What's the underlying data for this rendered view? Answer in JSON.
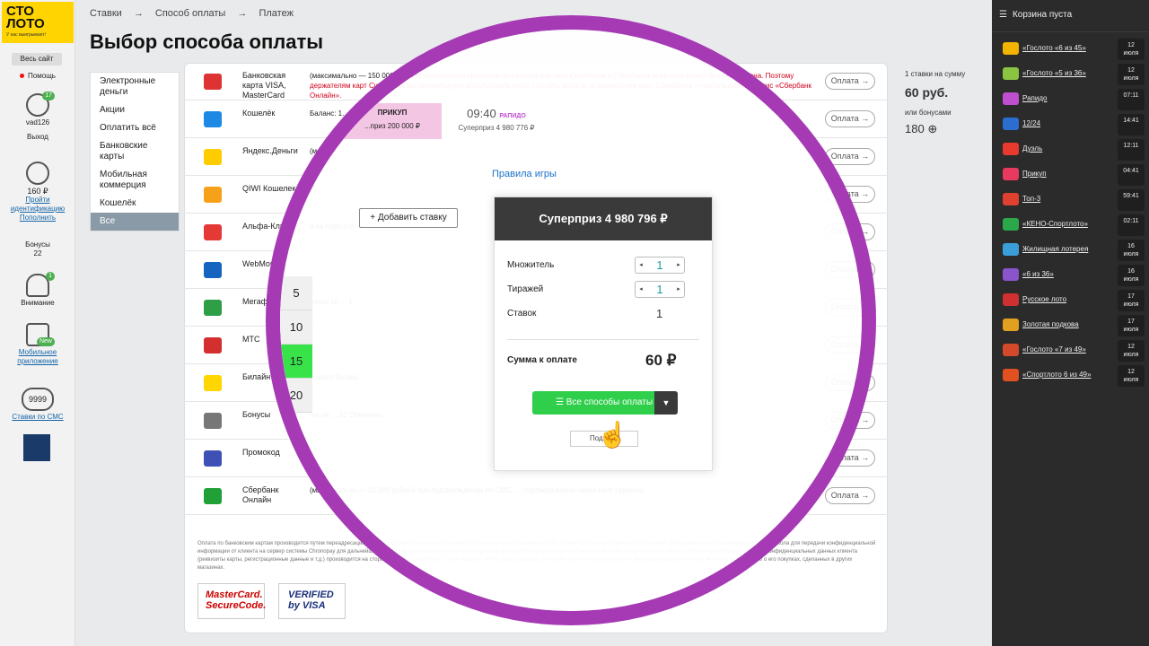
{
  "logo": {
    "line1": "СТО",
    "line2": "ЛОТО",
    "tagline": "У нас выигрывают!"
  },
  "left_sidebar": {
    "all_sites": "Весь сайт",
    "help": "Помощь",
    "user": "vad126",
    "user_badge": "17",
    "logout": "Выход",
    "balance": "160 ₽",
    "id_link": "Пройти идентификацию",
    "topup": "Пополнить",
    "bonuses_label": "Бонусы",
    "bonuses_value": "22",
    "attention_label": "Внимание",
    "attention_badge": "1",
    "mobile_label": "Мобильное приложение",
    "mobile_badge": "New",
    "sms_label": "Ставки по СМС",
    "sms_number": "9999"
  },
  "breadcrumbs": [
    "Ставки",
    "→",
    "Способ оплаты",
    "→",
    "Платеж"
  ],
  "page_title": "Выбор способа оплаты",
  "menu": [
    "Электронные деньги",
    "Акции",
    "Оплатить всё",
    "Банковские карты",
    "Мобильная коммерция",
    "Кошелёк",
    "Все"
  ],
  "pay_button_label": "Оплата →",
  "methods": [
    {
      "name": "Банковская карта VISA, MasterCard",
      "desc": "(максимально — 150 000 руб)",
      "desc_red": "По техническим причинам при оплате картами Ситибанка и Сбербанка операция может быть отклонена. Поэтому держателям карт Ситибанка мы рекомендуем использовать иные способы оплаты, а держателям карт Сбербанка — использовать сервис «Сбербанк Онлайн»."
    },
    {
      "name": "Кошелёк",
      "desc": "Баланс: 1...(макси...",
      "desc_red": ""
    },
    {
      "name": "Яндекс.Деньги",
      "desc": "(м",
      "desc_red": ""
    },
    {
      "name": "QIWI Кошелек",
      "desc": "",
      "desc_red": ""
    },
    {
      "name": "Альфа-Кли",
      "desc": "а на https://cli",
      "desc_red": ""
    },
    {
      "name": "WebMone",
      "desc": "",
      "desc_red": ""
    },
    {
      "name": "Мегафон",
      "desc": "ратор со ... 1",
      "desc_red": ""
    },
    {
      "name": "МТС",
      "desc": "",
      "desc_red": ""
    },
    {
      "name": "Билайн",
      "desc": "...ового баланс",
      "desc_red": ""
    },
    {
      "name": "Бонусы",
      "desc": "числе ... 22  Обновить",
      "desc_red": ""
    },
    {
      "name": "Промокод",
      "desc": "",
      "desc_red": ""
    },
    {
      "name": "Сбербанк Онлайн",
      "desc": "(максимально — 10 000 рублей при подтверждении по СМС, ... подтверждении через сайт сервиса)",
      "desc_red": ""
    }
  ],
  "summary": {
    "per_bet": "1 ставки на сумму",
    "amount": "60 руб.",
    "or_bonus": "или бонусами",
    "bonus": "180"
  },
  "footer_text": "Оплата по банковским картам производится путем переадресации на сайт системы электронных платежей Chronopay (www.chronopay.com). В системе Chronopay безопасность платежей обеспечивается использованием SSL протокола для передачи конфиденциальной информации от клиента на сервер системы Chronopay для дальнейшей обработки. Дальнейшая передача информации осуществляется по закрытым банковским сетям высшей степени защиты. Сбор и обработка полученных конфиденциальных данных клиента (реквизиты карты, регистрационные данные и т.д.) производится на стороне платежной системы. Таким образом, никто, даже продавец, не может получить персональные и банковские данные клиента, включая информацию о его покупках, сделанных в других магазинах.",
  "logos": {
    "mastercard_1": "MasterCard.",
    "mastercard_2": "SecureCode.",
    "visa_1": "VERIFIED",
    "visa_2": "by VISA"
  },
  "right_sidebar": {
    "cart": "Корзина пуста",
    "lotteries": [
      {
        "name": "«Гослото «6 из 45»",
        "time1": "12",
        "time2": "июля",
        "color": "#f2b400"
      },
      {
        "name": "«Гослото «5 из 36»",
        "time1": "12",
        "time2": "июля",
        "color": "#8ac541"
      },
      {
        "name": "Рапидо",
        "time1": "07:11",
        "time2": "",
        "color": "#c04fd0"
      },
      {
        "name": "12/24",
        "time1": "14:41",
        "time2": "",
        "color": "#2a6fd0"
      },
      {
        "name": "Дуэль",
        "time1": "12:11",
        "time2": "",
        "color": "#e83a2e"
      },
      {
        "name": "Прикуп",
        "time1": "04:41",
        "time2": "",
        "color": "#e83a5e"
      },
      {
        "name": "Топ-3",
        "time1": "59:41",
        "time2": "",
        "color": "#e04030"
      },
      {
        "name": "«КЕНО-Спортлото»",
        "time1": "02:11",
        "time2": "",
        "color": "#2aa84a"
      },
      {
        "name": "Жилищная лотерея",
        "time1": "16",
        "time2": "июля",
        "color": "#3a9fd8"
      },
      {
        "name": "«6 из 36»",
        "time1": "16",
        "time2": "июля",
        "color": "#8a55cc"
      },
      {
        "name": "Русское лото",
        "time1": "17",
        "time2": "июля",
        "color": "#d03030"
      },
      {
        "name": "Золотая подкова",
        "time1": "17",
        "time2": "июля",
        "color": "#e2a020"
      },
      {
        "name": "«Гослото «7 из 49»",
        "time1": "12",
        "time2": "июля",
        "color": "#d34a2a"
      },
      {
        "name": "«Спортлото 6 из 49»",
        "time1": "12",
        "time2": "июля",
        "color": "#e05020"
      }
    ]
  },
  "lens": {
    "tab_prikup": "ПРИКУП",
    "tab_prikup_sum": "...приз 200 000 ₽",
    "time": "09:40",
    "tab_rapido": "РАПИДО",
    "tab_rapido_sum": "Суперприз 4 980 776 ₽",
    "rules": "Правила игры",
    "add_bet": "Добавить ставку",
    "numbers": [
      "5",
      "10",
      "15",
      "20"
    ],
    "superprize": "Суперприз 4 980 796 ₽",
    "multiplier_label": "Множитель",
    "multiplier_value": "1",
    "draws_label": "Тиражей",
    "draws_value": "1",
    "bets_label": "Ставок",
    "bets_value": "1",
    "sum_label": "Сумма к оплате",
    "sum_value": "60 ₽",
    "all_methods": "Все способы оплаты",
    "hint": "Подз...гу"
  }
}
